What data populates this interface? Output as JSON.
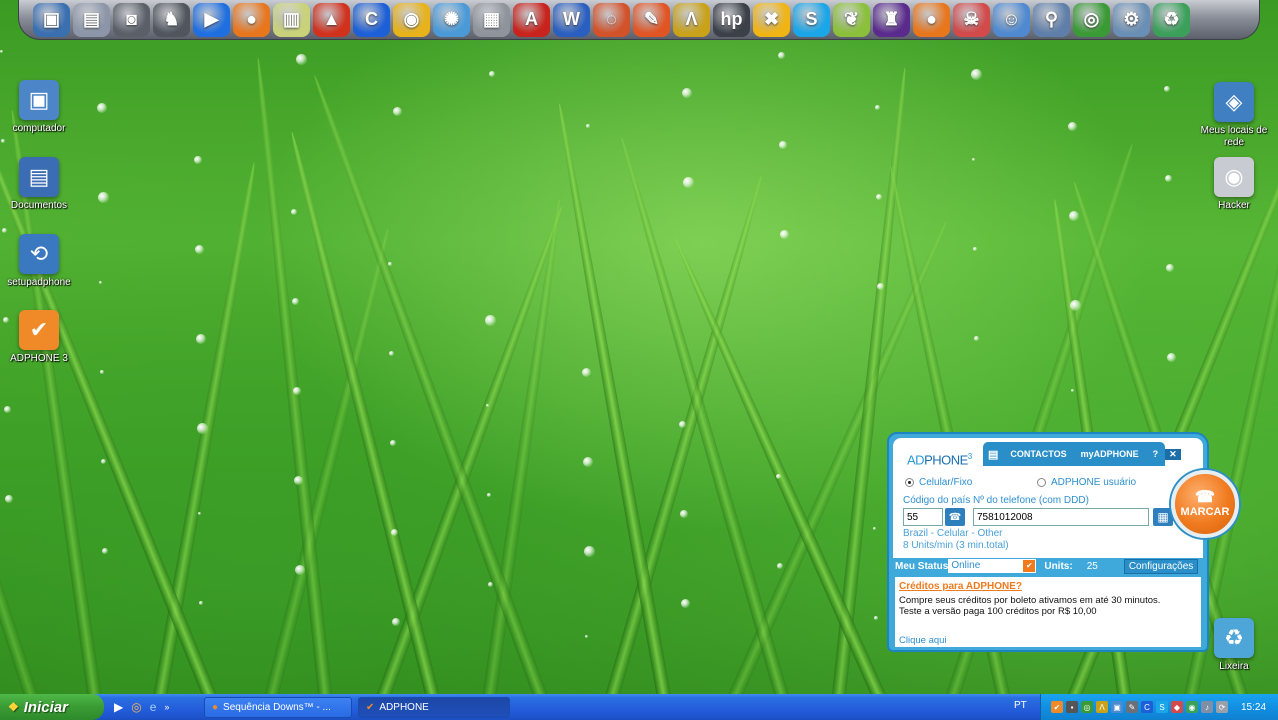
{
  "dock": {
    "icons": [
      {
        "name": "monitor-icon",
        "glyph": "▣",
        "color": "#3a6fb0"
      },
      {
        "name": "documents-icon",
        "glyph": "▤",
        "color": "#8c96a8"
      },
      {
        "name": "camera-icon",
        "glyph": "◙",
        "color": "#5a5f68"
      },
      {
        "name": "hacker-figure-icon",
        "glyph": "♞",
        "color": "#50555e"
      },
      {
        "name": "media-player-icon",
        "glyph": "▶",
        "color": "#1f6fe0"
      },
      {
        "name": "firefox-icon",
        "glyph": "●",
        "color": "#e8761d"
      },
      {
        "name": "notes-icon",
        "glyph": "▥",
        "color": "#c9d27a"
      },
      {
        "name": "burn-icon",
        "glyph": "▲",
        "color": "#d0321e"
      },
      {
        "name": "c-app-icon",
        "glyph": "C",
        "color": "#1d5fd6"
      },
      {
        "name": "disc-icon",
        "glyph": "◉",
        "color": "#e7b21a"
      },
      {
        "name": "molecule-icon",
        "glyph": "✺",
        "color": "#4a9ad8"
      },
      {
        "name": "printer-icon",
        "glyph": "▦",
        "color": "#8f949c"
      },
      {
        "name": "acrobat-icon",
        "glyph": "A",
        "color": "#c8231c"
      },
      {
        "name": "word-icon",
        "glyph": "W",
        "color": "#2b5fbf"
      },
      {
        "name": "photo-icon",
        "glyph": "◌",
        "color": "#d2522a"
      },
      {
        "name": "paint-icon",
        "glyph": "✎",
        "color": "#e15525"
      },
      {
        "name": "avast-icon",
        "glyph": "Λ",
        "color": "#c9a21a"
      },
      {
        "name": "hp-icon",
        "glyph": "hp",
        "color": "#3c4048"
      },
      {
        "name": "tools-icon",
        "glyph": "✖",
        "color": "#f0b415"
      },
      {
        "name": "skype-icon",
        "glyph": "S",
        "color": "#1ba6e8"
      },
      {
        "name": "leaf-icon",
        "glyph": "❦",
        "color": "#8bc03a"
      },
      {
        "name": "purple-figure-icon",
        "glyph": "♜",
        "color": "#5a2b8c"
      },
      {
        "name": "firefox-2-icon",
        "glyph": "●",
        "color": "#e8761d"
      },
      {
        "name": "octopus-icon",
        "glyph": "☠",
        "color": "#d24a4a"
      },
      {
        "name": "users-icon",
        "glyph": "☺",
        "color": "#4f8ad0"
      },
      {
        "name": "search-icon",
        "glyph": "⚲",
        "color": "#5f7faa"
      },
      {
        "name": "chrome-icon",
        "glyph": "◎",
        "color": "#3a9a35"
      },
      {
        "name": "settings-icon",
        "glyph": "⚙",
        "color": "#6a8fb5"
      },
      {
        "name": "recycle-icon",
        "glyph": "♻",
        "color": "#3aa05a"
      }
    ]
  },
  "desktop": {
    "left_icons": [
      {
        "label": "computador",
        "glyph": "▣",
        "color": "#4d86c8"
      },
      {
        "label": "Documentos",
        "glyph": "▤",
        "color": "#3b6db5"
      },
      {
        "label": "setupadphone",
        "glyph": "⟲",
        "color": "#3a78c0"
      },
      {
        "label": "ADPHONE 3",
        "glyph": "✔",
        "color": "#f08a28"
      }
    ],
    "right_icons": [
      {
        "label": "Meus locais de rede",
        "glyph": "◈",
        "color": "#3f7fc2"
      },
      {
        "label": "Hacker",
        "glyph": "◉",
        "color": "#c8ccd2"
      },
      {
        "label": "Lixeira",
        "glyph": "♻",
        "color": "#4ea6d8"
      }
    ]
  },
  "adphone": {
    "logo_ad": "AD",
    "logo_phone": "PHONE",
    "logo_sup": "3",
    "tab_contacts": "CONTACTOS",
    "tab_my": "myADPHONE",
    "tab_help": "?",
    "tab_close": "✕",
    "radio_cell": "Celular/Fixo",
    "radio_user": "ADPHONE usuário",
    "label_code": "Código do país",
    "label_number": "Nº do telefone (com DDD)",
    "country_code": "55",
    "phone_number": "7581012008",
    "dest_info": "Brazil - Celular - Other",
    "rate_info": "8 Units/min (3 min.total)",
    "call_label": "MARCAR",
    "status_label": "Meu Status",
    "status_value": "Online",
    "units_label": "Units:",
    "units_value": "25",
    "config_label": "Configurações",
    "promo_title": "Créditos para ADPHONE?",
    "promo_line1": "Compre seus créditos por boleto ativamos em até 30 minutos.",
    "promo_line2": "Teste a versão paga 100 créditos por R$ 10,00",
    "promo_link": "Clique aqui",
    "accent": "#3fa9dc",
    "orange": "#f07a1e"
  },
  "taskbar": {
    "start_label": "Iniciar",
    "task1": "Sequência Downs™ - ...",
    "task2": "ADPHONE",
    "lang": "PT",
    "clock": "15:24"
  }
}
